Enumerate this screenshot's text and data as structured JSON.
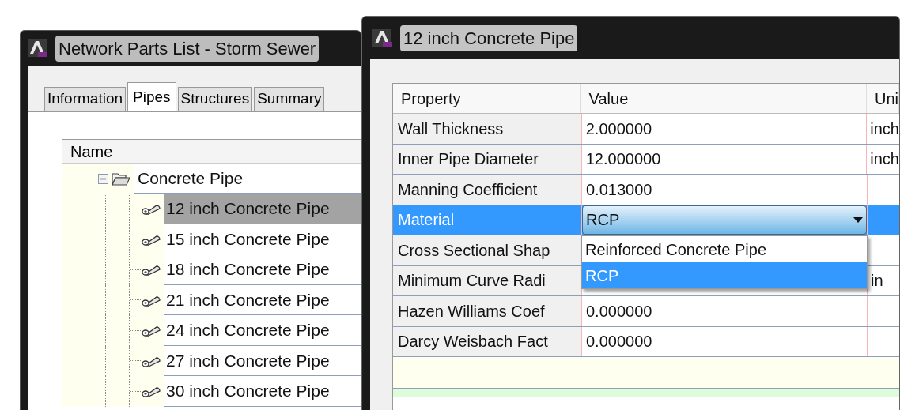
{
  "parts_window": {
    "title": "Network Parts List - Storm Sewer",
    "tabs": [
      {
        "label": "Information",
        "selected": false
      },
      {
        "label": "Pipes",
        "selected": true
      },
      {
        "label": "Structures",
        "selected": false
      },
      {
        "label": "Summary",
        "selected": false
      }
    ],
    "tree": {
      "column": "Name",
      "items": [
        {
          "label": "Concrete Pipe",
          "expanded": true,
          "children": [
            {
              "label": "12 inch Concrete Pipe",
              "selected": true
            },
            {
              "label": "15 inch Concrete Pipe",
              "selected": false
            },
            {
              "label": "18 inch Concrete Pipe",
              "selected": false
            },
            {
              "label": "21 inch Concrete Pipe",
              "selected": false
            },
            {
              "label": "24 inch Concrete Pipe",
              "selected": false
            },
            {
              "label": "27 inch Concrete Pipe",
              "selected": false
            },
            {
              "label": "30 inch Concrete Pipe",
              "selected": false
            }
          ]
        }
      ]
    }
  },
  "pipe_window": {
    "title": "12 inch Concrete Pipe",
    "table": {
      "columns": [
        "Property",
        "Value",
        "Uni"
      ],
      "rows": [
        {
          "kind": "text",
          "property": "Wall Thickness",
          "value": "2.000000",
          "unit": "inch",
          "selected": false
        },
        {
          "kind": "text",
          "property": "Inner Pipe Diameter",
          "value": "12.000000",
          "unit": "inch",
          "selected": false
        },
        {
          "kind": "text",
          "property": "Manning Coefficient",
          "value": "0.013000",
          "selected": false
        },
        {
          "kind": "dropdown",
          "property": "Material",
          "value": "RCP",
          "selected": true,
          "options": [
            {
              "label": "Reinforced Concrete Pipe",
              "selected": false
            },
            {
              "label": "RCP",
              "selected": true
            }
          ]
        },
        {
          "kind": "text",
          "property": "Cross Sectional Shap",
          "selected": false
        },
        {
          "kind": "text",
          "property": "Minimum Curve Radi",
          "unit": "in",
          "selected": false
        },
        {
          "kind": "text",
          "property": "Hazen Williams Coef",
          "value": "0.000000",
          "selected": false
        },
        {
          "kind": "text",
          "property": "Darcy Weisbach Fact",
          "value": "0.000000",
          "selected": false
        }
      ]
    }
  }
}
